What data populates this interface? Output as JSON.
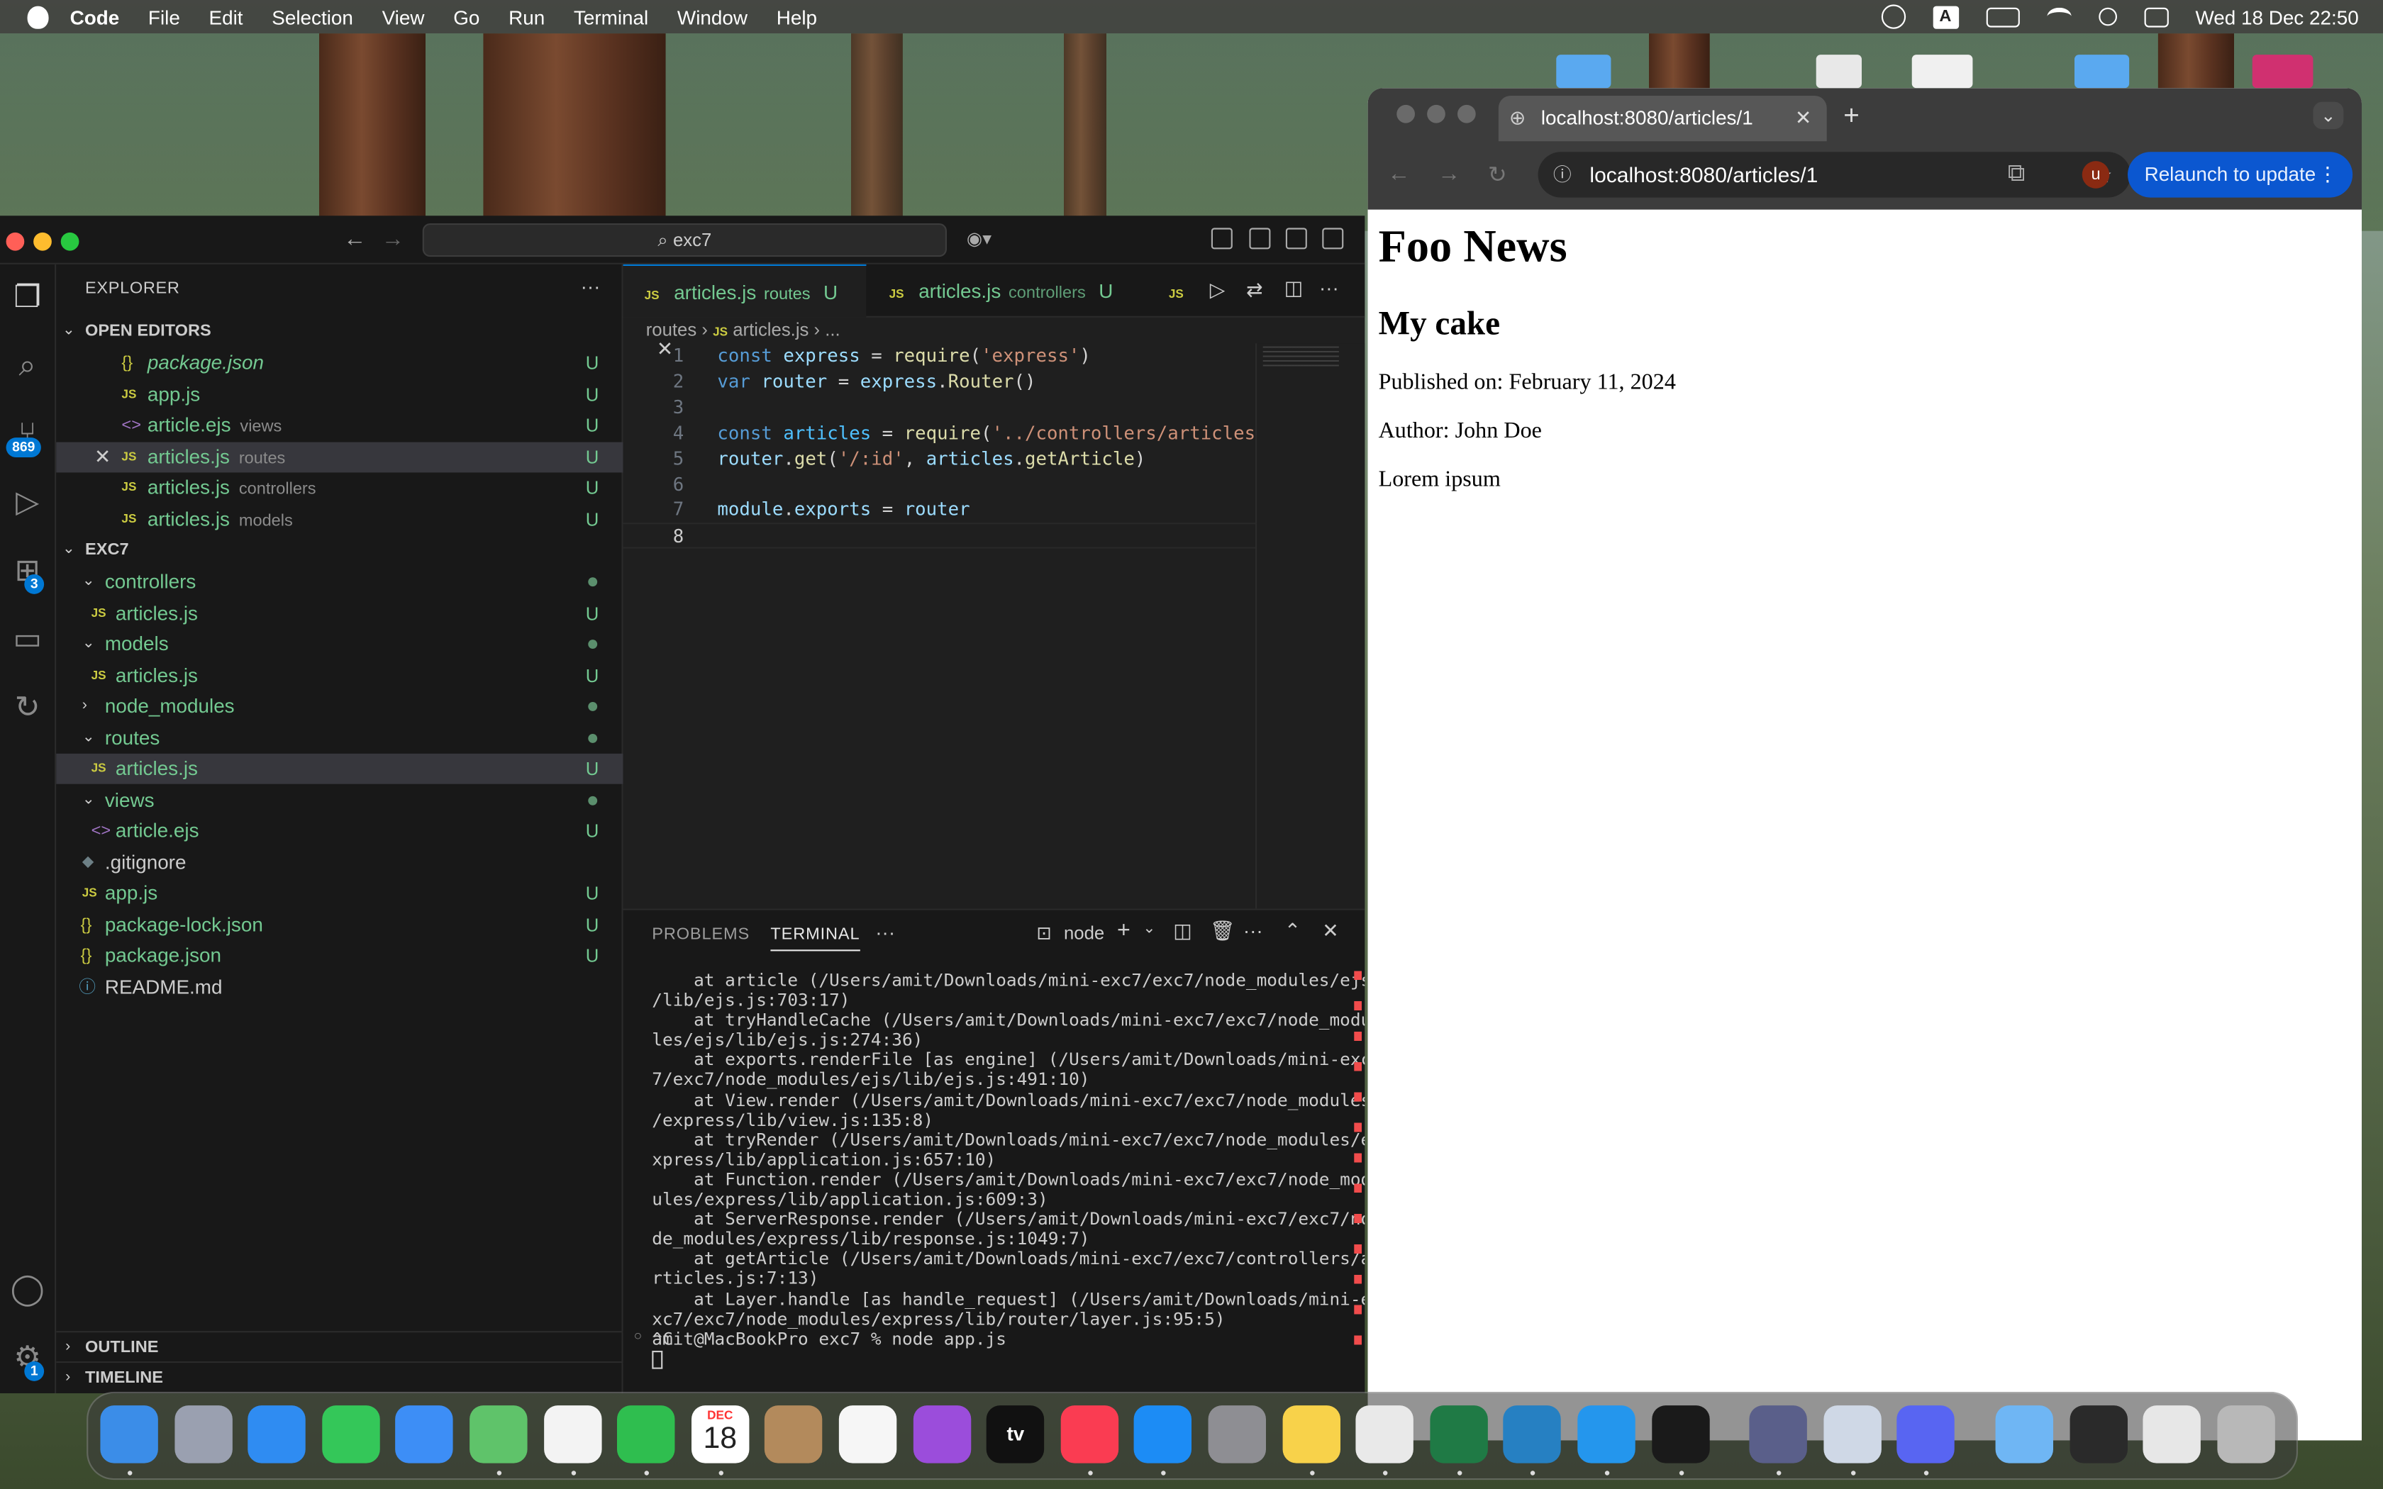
{
  "menubar": {
    "app_name": "Code",
    "menus": [
      "File",
      "Edit",
      "Selection",
      "View",
      "Go",
      "Run",
      "Terminal",
      "Window",
      "Help"
    ],
    "input_indicator": "A",
    "clock": "Wed 18 Dec  22:50"
  },
  "vscode": {
    "search_text": "exc7",
    "explorer_title": "EXPLORER",
    "open_editors_header": "OPEN EDITORS",
    "open_editors": [
      {
        "name": "package.json",
        "hint": "",
        "status": "U",
        "italic": true
      },
      {
        "name": "app.js",
        "hint": "",
        "status": "U"
      },
      {
        "name": "article.ejs",
        "hint": "views",
        "status": "U"
      },
      {
        "name": "articles.js",
        "hint": "routes",
        "status": "U"
      },
      {
        "name": "articles.js",
        "hint": "controllers",
        "status": "U"
      },
      {
        "name": "articles.js",
        "hint": "models",
        "status": "U"
      }
    ],
    "project_header": "EXC7",
    "tree": [
      {
        "name": "controllers",
        "status": ""
      },
      {
        "name": "articles.js",
        "status": "U"
      },
      {
        "name": "models",
        "status": ""
      },
      {
        "name": "articles.js",
        "status": "U"
      },
      {
        "name": "node_modules",
        "status": ""
      },
      {
        "name": "routes",
        "status": ""
      },
      {
        "name": "articles.js",
        "status": "U"
      },
      {
        "name": "views",
        "status": ""
      },
      {
        "name": "article.ejs",
        "status": "U"
      },
      {
        "name": ".gitignore",
        "status": ""
      },
      {
        "name": "app.js",
        "status": "U"
      },
      {
        "name": "package-lock.json",
        "status": "U"
      },
      {
        "name": "package.json",
        "status": "U"
      },
      {
        "name": "README.md",
        "status": ""
      }
    ],
    "outline_header": "OUTLINE",
    "timeline_header": "TIMELINE",
    "badges": {
      "source_control": "869",
      "extensions": "3",
      "settings": "1"
    },
    "tabs": [
      {
        "name": "articles.js",
        "hint": "routes",
        "status": "U"
      },
      {
        "name": "articles.js",
        "hint": "controllers",
        "status": "U"
      }
    ],
    "tab_ellipsis_icon": "JS",
    "breadcrumb": [
      "routes",
      "articles.js",
      "..."
    ],
    "code": [
      {
        "n": "1",
        "tokens": [
          [
            "kw",
            "const "
          ],
          [
            "var",
            "express"
          ],
          [
            "pl",
            " = "
          ],
          [
            "fn",
            "require"
          ],
          [
            "pl",
            "("
          ],
          [
            "str",
            "'express'"
          ],
          [
            "pl",
            ")"
          ]
        ]
      },
      {
        "n": "2",
        "tokens": [
          [
            "kw",
            "var "
          ],
          [
            "var",
            "router"
          ],
          [
            "pl",
            " = "
          ],
          [
            "var",
            "express"
          ],
          [
            "pl",
            "."
          ],
          [
            "fn",
            "Router"
          ],
          [
            "pl",
            "()"
          ]
        ]
      },
      {
        "n": "3",
        "tokens": []
      },
      {
        "n": "4",
        "tokens": [
          [
            "kw",
            "const "
          ],
          [
            "cn",
            "articles"
          ],
          [
            "pl",
            " = "
          ],
          [
            "fn",
            "require"
          ],
          [
            "pl",
            "("
          ],
          [
            "str",
            "'../controllers/articles'"
          ],
          [
            "pl",
            ")"
          ]
        ]
      },
      {
        "n": "5",
        "tokens": [
          [
            "var",
            "router"
          ],
          [
            "pl",
            "."
          ],
          [
            "fn",
            "get"
          ],
          [
            "pl",
            "("
          ],
          [
            "str",
            "'/:id'"
          ],
          [
            "pl",
            ", "
          ],
          [
            "var",
            "articles"
          ],
          [
            "pl",
            "."
          ],
          [
            "fn",
            "getArticle"
          ],
          [
            "pl",
            ")"
          ]
        ]
      },
      {
        "n": "6",
        "tokens": []
      },
      {
        "n": "7",
        "tokens": [
          [
            "var",
            "module"
          ],
          [
            "pl",
            "."
          ],
          [
            "var",
            "exports"
          ],
          [
            "pl",
            " = "
          ],
          [
            "var",
            "router"
          ]
        ]
      },
      {
        "n": "8",
        "tokens": []
      }
    ],
    "panel": {
      "problems": "PROBLEMS",
      "terminal": "TERMINAL",
      "shell": "node",
      "lines": [
        "    at article (/Users/amit/Downloads/mini-exc7/exc7/node_modules/ejs",
        "/lib/ejs.js:703:17)",
        "    at tryHandleCache (/Users/amit/Downloads/mini-exc7/exc7/node_modu",
        "les/ejs/lib/ejs.js:274:36)",
        "    at exports.renderFile [as engine] (/Users/amit/Downloads/mini-exc",
        "7/exc7/node_modules/ejs/lib/ejs.js:491:10)",
        "    at View.render (/Users/amit/Downloads/mini-exc7/exc7/node_modules",
        "/express/lib/view.js:135:8)",
        "    at tryRender (/Users/amit/Downloads/mini-exc7/exc7/node_modules/e",
        "xpress/lib/application.js:657:10)",
        "    at Function.render (/Users/amit/Downloads/mini-exc7/exc7/node_mod",
        "ules/express/lib/application.js:609:3)",
        "    at ServerResponse.render (/Users/amit/Downloads/mini-exc7/exc7/no",
        "de_modules/express/lib/response.js:1049:7)",
        "    at getArticle (/Users/amit/Downloads/mini-exc7/exc7/controllers/a",
        "rticles.js:7:13)",
        "    at Layer.handle [as handle_request] (/Users/amit/Downloads/mini-e",
        "xc7/exc7/node_modules/express/lib/router/layer.js:95:5)",
        "^C"
      ],
      "prompt": "amit@MacBookPro exc7 % node app.js"
    },
    "status_text": "m"
  },
  "chrome": {
    "tab_title": "localhost:8080/articles/1",
    "url": "localhost:8080/articles/1",
    "profile_initial": "u",
    "relaunch_label": "Relaunch to update",
    "page": {
      "site_title": "Foo News",
      "article_title": "My cake",
      "published": "Published on: February 11, 2024",
      "author": "Author: John Doe",
      "body": "Lorem ipsum"
    }
  },
  "dock": {
    "calendar_month": "DEC",
    "calendar_day": "18",
    "tv_label": "tv",
    "apps": [
      "finder",
      "launchpad",
      "safari",
      "messages",
      "mail",
      "maps",
      "photos",
      "facetime",
      "calendar",
      "contacts",
      "reminders",
      "podcasts",
      "tv",
      "music",
      "app-store",
      "system-settings",
      "notes",
      "chrome",
      "excel",
      "vscode",
      "docker",
      "terminal",
      "bbedit",
      "preview",
      "discord",
      "downloads-folder",
      "window-1",
      "window-2",
      "trash"
    ]
  }
}
